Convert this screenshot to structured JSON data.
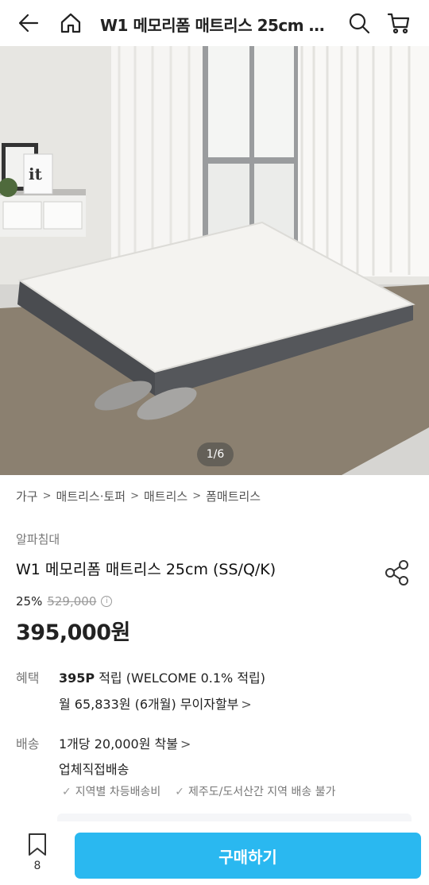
{
  "header": {
    "title": "W1 메모리폼 매트리스 25cm (SS/Q/K)",
    "icons": [
      "back-arrow-icon",
      "home-icon",
      "search-icon",
      "cart-icon"
    ]
  },
  "gallery": {
    "pager": "1/6"
  },
  "breadcrumb": [
    "가구",
    "매트리스·토퍼",
    "매트리스",
    "폼매트리스"
  ],
  "product": {
    "brand": "알파침대",
    "name": "W1 메모리폼 매트리스 25cm (SS/Q/K)",
    "discount": "25%",
    "original_price": "529,000",
    "price": "395,000원"
  },
  "benefit": {
    "label": "혜택",
    "points": "395P",
    "points_text": " 적립 (WELCOME 0.1% 적립)",
    "installment": "월 65,833원 (6개월) 무이자할부"
  },
  "shipping": {
    "label": "배송",
    "fee": "1개당 20,000원 착불",
    "method": "업체직접배송",
    "notes": [
      "지역별 차등배송비",
      "제주도/도서산간 지역 배송 불가"
    ]
  },
  "bottom_bar": {
    "wish_count": "8",
    "buy_label": "구매하기"
  },
  "colors": {
    "accent": "#2ab8f0",
    "text": "#222222"
  }
}
